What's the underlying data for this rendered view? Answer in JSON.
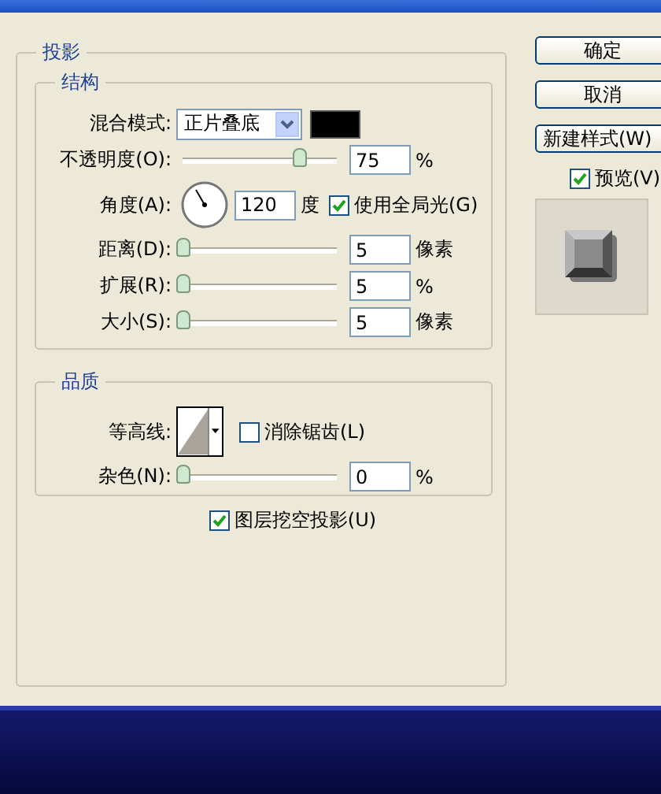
{
  "title": "投影",
  "structure": {
    "title": "结构",
    "blend_mode": {
      "label": "混合模式:",
      "value": "正片叠底"
    },
    "opacity": {
      "label": "不透明度(O):",
      "level": 0.75,
      "value": "75",
      "unit": "%"
    },
    "angle": {
      "label": "角度(A):",
      "value": "120",
      "unit": "度"
    },
    "global_light": {
      "label": "使用全局光(G)",
      "checked": true
    },
    "sliders": [
      {
        "label": "距离(D):",
        "level": 0,
        "value": "5",
        "unit": "像素"
      },
      {
        "label": "扩展(R):",
        "level": 0,
        "value": "5",
        "unit": "%"
      },
      {
        "label": "大小(S):",
        "level": 0,
        "value": "5",
        "unit": "像素"
      }
    ]
  },
  "quality": {
    "title": "品质",
    "contour_label": "等高线:",
    "anti_alias": {
      "label": "消除锯齿(L)",
      "checked": false
    },
    "noise": {
      "label": "杂色(N):",
      "level": 0,
      "value": "0",
      "unit": "%"
    }
  },
  "knockout": {
    "label": "图层挖空投影(U)",
    "checked": true
  },
  "buttons": [
    "确定",
    "取消",
    "新建样式(W)"
  ],
  "preview": {
    "label": "预览(V)",
    "checked": true
  }
}
